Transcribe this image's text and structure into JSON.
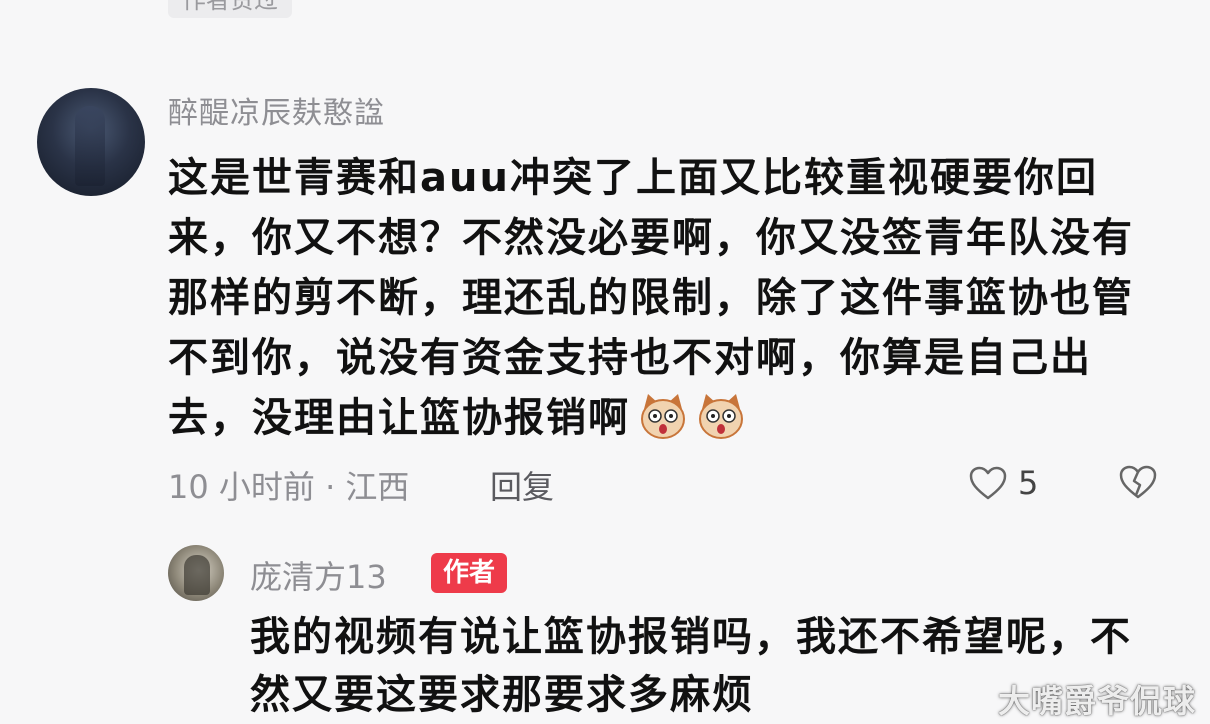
{
  "top_badge": "作者赞过",
  "comment": {
    "username": "醉醍凉辰麸憨諡",
    "text": "这是世青赛和auu冲突了上面又比较重视硬要你回来，你又不想？不然没必要啊，你又没签青年队没有那样的剪不断，理还乱的限制，除了这件事篮协也管不到你，说没有资金支持也不对啊，你算是自己出去，没理由让篮协报销啊",
    "emojis": [
      "shocked-dog-emoji",
      "shocked-dog-emoji"
    ],
    "meta": "10 小时前 · 江西",
    "reply_label": "回复",
    "like_count": "5"
  },
  "reply": {
    "username": "庞清方13",
    "badge": "作者",
    "text": "我的视频有说让篮协报销吗，我还不希望呢，不然又要这要求那要求多麻烦"
  },
  "watermark": "大嘴爵爷侃球",
  "colors": {
    "background": "#f7f7f8",
    "author_badge": "#ee3b4a",
    "muted_text": "#8e8e93"
  }
}
